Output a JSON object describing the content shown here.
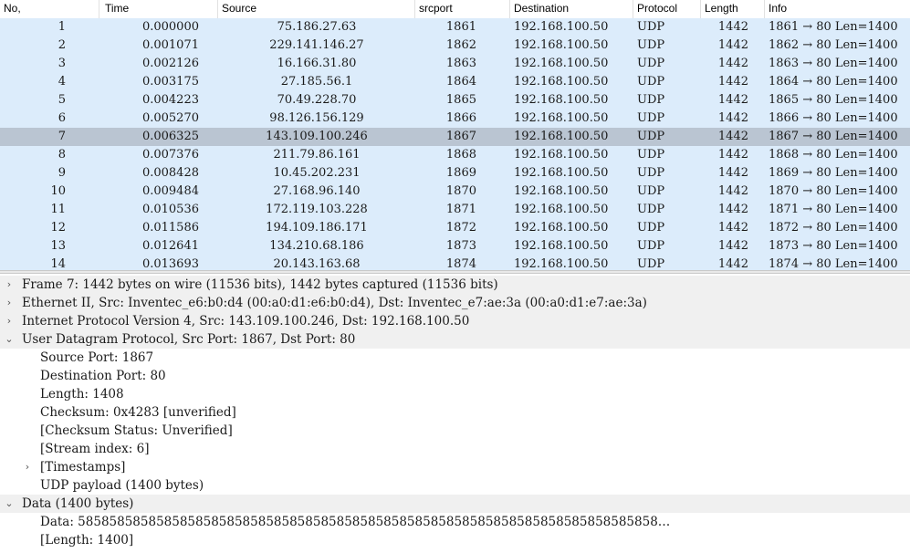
{
  "packet_list": {
    "columns": [
      "No,",
      "Time",
      "Source",
      "srcport",
      "Destination",
      "Protocol",
      "Length",
      "Info"
    ],
    "selected_no": "7",
    "rows": [
      {
        "no": "1",
        "time": "0.000000",
        "source": "75.186.27.63",
        "srcport": "1861",
        "destination": "192.168.100.50",
        "protocol": "UDP",
        "length": "1442",
        "info": "1861 → 80 Len=1400"
      },
      {
        "no": "2",
        "time": "0.001071",
        "source": "229.141.146.27",
        "srcport": "1862",
        "destination": "192.168.100.50",
        "protocol": "UDP",
        "length": "1442",
        "info": "1862 → 80 Len=1400"
      },
      {
        "no": "3",
        "time": "0.002126",
        "source": "16.166.31.80",
        "srcport": "1863",
        "destination": "192.168.100.50",
        "protocol": "UDP",
        "length": "1442",
        "info": "1863 → 80 Len=1400"
      },
      {
        "no": "4",
        "time": "0.003175",
        "source": "27.185.56.1",
        "srcport": "1864",
        "destination": "192.168.100.50",
        "protocol": "UDP",
        "length": "1442",
        "info": "1864 → 80 Len=1400"
      },
      {
        "no": "5",
        "time": "0.004223",
        "source": "70.49.228.70",
        "srcport": "1865",
        "destination": "192.168.100.50",
        "protocol": "UDP",
        "length": "1442",
        "info": "1865 → 80 Len=1400"
      },
      {
        "no": "6",
        "time": "0.005270",
        "source": "98.126.156.129",
        "srcport": "1866",
        "destination": "192.168.100.50",
        "protocol": "UDP",
        "length": "1442",
        "info": "1866 → 80 Len=1400"
      },
      {
        "no": "7",
        "time": "0.006325",
        "source": "143.109.100.246",
        "srcport": "1867",
        "destination": "192.168.100.50",
        "protocol": "UDP",
        "length": "1442",
        "info": "1867 → 80 Len=1400"
      },
      {
        "no": "8",
        "time": "0.007376",
        "source": "211.79.86.161",
        "srcport": "1868",
        "destination": "192.168.100.50",
        "protocol": "UDP",
        "length": "1442",
        "info": "1868 → 80 Len=1400"
      },
      {
        "no": "9",
        "time": "0.008428",
        "source": "10.45.202.231",
        "srcport": "1869",
        "destination": "192.168.100.50",
        "protocol": "UDP",
        "length": "1442",
        "info": "1869 → 80 Len=1400"
      },
      {
        "no": "10",
        "time": "0.009484",
        "source": "27.168.96.140",
        "srcport": "1870",
        "destination": "192.168.100.50",
        "protocol": "UDP",
        "length": "1442",
        "info": "1870 → 80 Len=1400"
      },
      {
        "no": "11",
        "time": "0.010536",
        "source": "172.119.103.228",
        "srcport": "1871",
        "destination": "192.168.100.50",
        "protocol": "UDP",
        "length": "1442",
        "info": "1871 → 80 Len=1400"
      },
      {
        "no": "12",
        "time": "0.011586",
        "source": "194.109.186.171",
        "srcport": "1872",
        "destination": "192.168.100.50",
        "protocol": "UDP",
        "length": "1442",
        "info": "1872 → 80 Len=1400"
      },
      {
        "no": "13",
        "time": "0.012641",
        "source": "134.210.68.186",
        "srcport": "1873",
        "destination": "192.168.100.50",
        "protocol": "UDP",
        "length": "1442",
        "info": "1873 → 80 Len=1400"
      },
      {
        "no": "14",
        "time": "0.013693",
        "source": "20.143.163.68",
        "srcport": "1874",
        "destination": "192.168.100.50",
        "protocol": "UDP",
        "length": "1442",
        "info": "1874 → 80 Len=1400"
      }
    ]
  },
  "details": {
    "lines": [
      {
        "level": 0,
        "arrow": "›",
        "text": "Frame 7: 1442 bytes on wire (11536 bits), 1442 bytes captured (11536 bits)",
        "interactable": true
      },
      {
        "level": 0,
        "arrow": "›",
        "text": "Ethernet II, Src: Inventec_e6:b0:d4 (00:a0:d1:e6:b0:d4), Dst: Inventec_e7:ae:3a (00:a0:d1:e7:ae:3a)",
        "interactable": true
      },
      {
        "level": 0,
        "arrow": "›",
        "text": "Internet Protocol Version 4, Src: 143.109.100.246, Dst: 192.168.100.50",
        "interactable": true
      },
      {
        "level": 0,
        "arrow": "⌄",
        "text": "User Datagram Protocol, Src Port: 1867, Dst Port: 80",
        "interactable": true
      },
      {
        "level": 1,
        "arrow": "",
        "text": "Source Port: 1867",
        "interactable": true
      },
      {
        "level": 1,
        "arrow": "",
        "text": "Destination Port: 80",
        "interactable": true
      },
      {
        "level": 1,
        "arrow": "",
        "text": "Length: 1408",
        "interactable": true
      },
      {
        "level": 1,
        "arrow": "",
        "text": "Checksum: 0x4283 [unverified]",
        "interactable": true
      },
      {
        "level": 1,
        "arrow": "",
        "text": "[Checksum Status: Unverified]",
        "interactable": true
      },
      {
        "level": 1,
        "arrow": "",
        "text": "[Stream index: 6]",
        "interactable": true
      },
      {
        "level": 1,
        "arrow": "›",
        "text": "[Timestamps]",
        "interactable": true
      },
      {
        "level": 1,
        "arrow": "",
        "text": "UDP payload (1400 bytes)",
        "interactable": true
      },
      {
        "level": 0,
        "arrow": "⌄",
        "text": "Data (1400 bytes)",
        "interactable": true
      },
      {
        "level": 1,
        "arrow": "",
        "text": "Data: 58585858585858585858585858585858585858585858585858585858585858585858585858…",
        "interactable": true
      },
      {
        "level": 1,
        "arrow": "",
        "text": "[Length: 1400]",
        "interactable": true
      }
    ]
  },
  "colors": {
    "row_bg": "#dcecfb",
    "row_selected_bg": "#bac5d2",
    "top_level_tree_bg": "#f0f0f0"
  }
}
